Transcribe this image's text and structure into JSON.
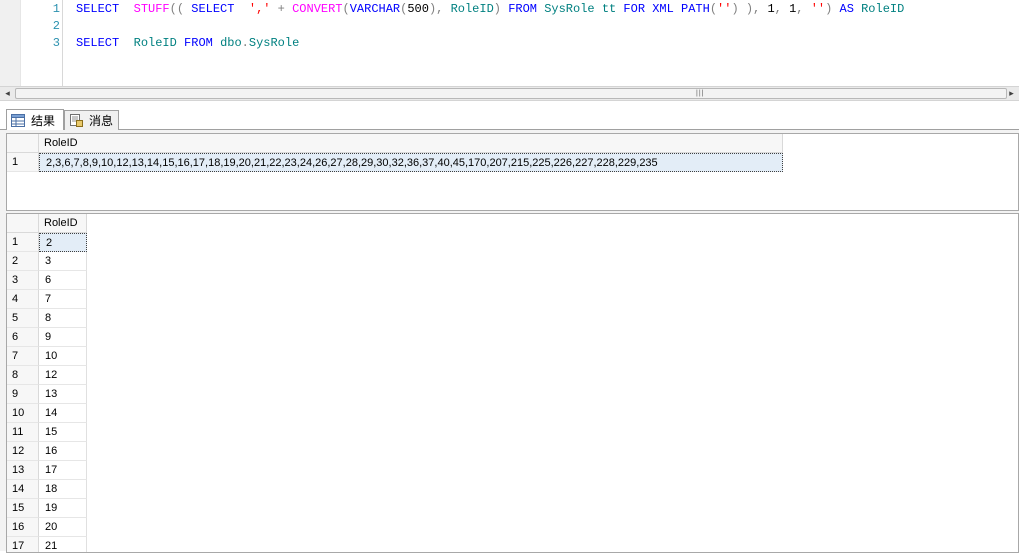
{
  "editor": {
    "lines": [
      {
        "num": "1",
        "tokens": [
          {
            "t": "SELECT",
            "c": "kw"
          },
          {
            "t": "  ",
            "c": ""
          },
          {
            "t": "STUFF",
            "c": "fn"
          },
          {
            "t": "((",
            "c": "op"
          },
          {
            "t": " ",
            "c": ""
          },
          {
            "t": "SELECT",
            "c": "kw"
          },
          {
            "t": "  ",
            "c": ""
          },
          {
            "t": "','",
            "c": "str"
          },
          {
            "t": " + ",
            "c": "op"
          },
          {
            "t": "CONVERT",
            "c": "fn"
          },
          {
            "t": "(",
            "c": "op"
          },
          {
            "t": "VARCHAR",
            "c": "kw"
          },
          {
            "t": "(",
            "c": "op"
          },
          {
            "t": "500",
            "c": ""
          },
          {
            "t": "),",
            "c": "op"
          },
          {
            "t": " ",
            "c": ""
          },
          {
            "t": "RoleID",
            "c": "id"
          },
          {
            "t": ")",
            "c": "op"
          },
          {
            "t": " ",
            "c": ""
          },
          {
            "t": "FROM",
            "c": "kw"
          },
          {
            "t": " ",
            "c": ""
          },
          {
            "t": "SysRole tt",
            "c": "id"
          },
          {
            "t": " ",
            "c": ""
          },
          {
            "t": "FOR XML PATH",
            "c": "kw"
          },
          {
            "t": "(",
            "c": "op"
          },
          {
            "t": "''",
            "c": "str"
          },
          {
            "t": ")",
            "c": "op"
          },
          {
            "t": " ), ",
            "c": "op"
          },
          {
            "t": "1",
            "c": ""
          },
          {
            "t": ", ",
            "c": "op"
          },
          {
            "t": "1",
            "c": ""
          },
          {
            "t": ", ",
            "c": "op"
          },
          {
            "t": "''",
            "c": "str"
          },
          {
            "t": ")",
            "c": "op"
          },
          {
            "t": " ",
            "c": ""
          },
          {
            "t": "AS",
            "c": "kw"
          },
          {
            "t": " ",
            "c": ""
          },
          {
            "t": "RoleID",
            "c": "id"
          }
        ]
      },
      {
        "num": "2",
        "tokens": []
      },
      {
        "num": "3",
        "tokens": [
          {
            "t": "SELECT",
            "c": "kw"
          },
          {
            "t": "  ",
            "c": ""
          },
          {
            "t": "RoleID",
            "c": "id"
          },
          {
            "t": " ",
            "c": ""
          },
          {
            "t": "FROM",
            "c": "kw"
          },
          {
            "t": " ",
            "c": ""
          },
          {
            "t": "dbo",
            "c": "id"
          },
          {
            "t": ".",
            "c": "op"
          },
          {
            "t": "SysRole",
            "c": "id"
          }
        ]
      }
    ]
  },
  "scrollbar": {
    "left_arrow": "◂",
    "right_arrow": "▸",
    "grip": "|||"
  },
  "tabs": [
    {
      "label": "结果",
      "icon": "grid-icon",
      "active": true
    },
    {
      "label": "消息",
      "icon": "message-icon",
      "active": false
    }
  ],
  "result1": {
    "columns": [
      "RoleID"
    ],
    "rows": [
      {
        "num": "1",
        "value": "2,3,6,7,8,9,10,12,13,14,15,16,17,18,19,20,21,22,23,24,26,27,28,29,30,32,36,37,40,45,170,207,215,225,226,227,228,229,235"
      }
    ]
  },
  "result2": {
    "columns": [
      "RoleID"
    ],
    "rows": [
      {
        "num": "1",
        "value": "2"
      },
      {
        "num": "2",
        "value": "3"
      },
      {
        "num": "3",
        "value": "6"
      },
      {
        "num": "4",
        "value": "7"
      },
      {
        "num": "5",
        "value": "8"
      },
      {
        "num": "6",
        "value": "9"
      },
      {
        "num": "7",
        "value": "10"
      },
      {
        "num": "8",
        "value": "12"
      },
      {
        "num": "9",
        "value": "13"
      },
      {
        "num": "10",
        "value": "14"
      },
      {
        "num": "11",
        "value": "15"
      },
      {
        "num": "12",
        "value": "16"
      },
      {
        "num": "13",
        "value": "17"
      },
      {
        "num": "14",
        "value": "18"
      },
      {
        "num": "15",
        "value": "19"
      },
      {
        "num": "16",
        "value": "20"
      },
      {
        "num": "17",
        "value": "21"
      }
    ]
  }
}
